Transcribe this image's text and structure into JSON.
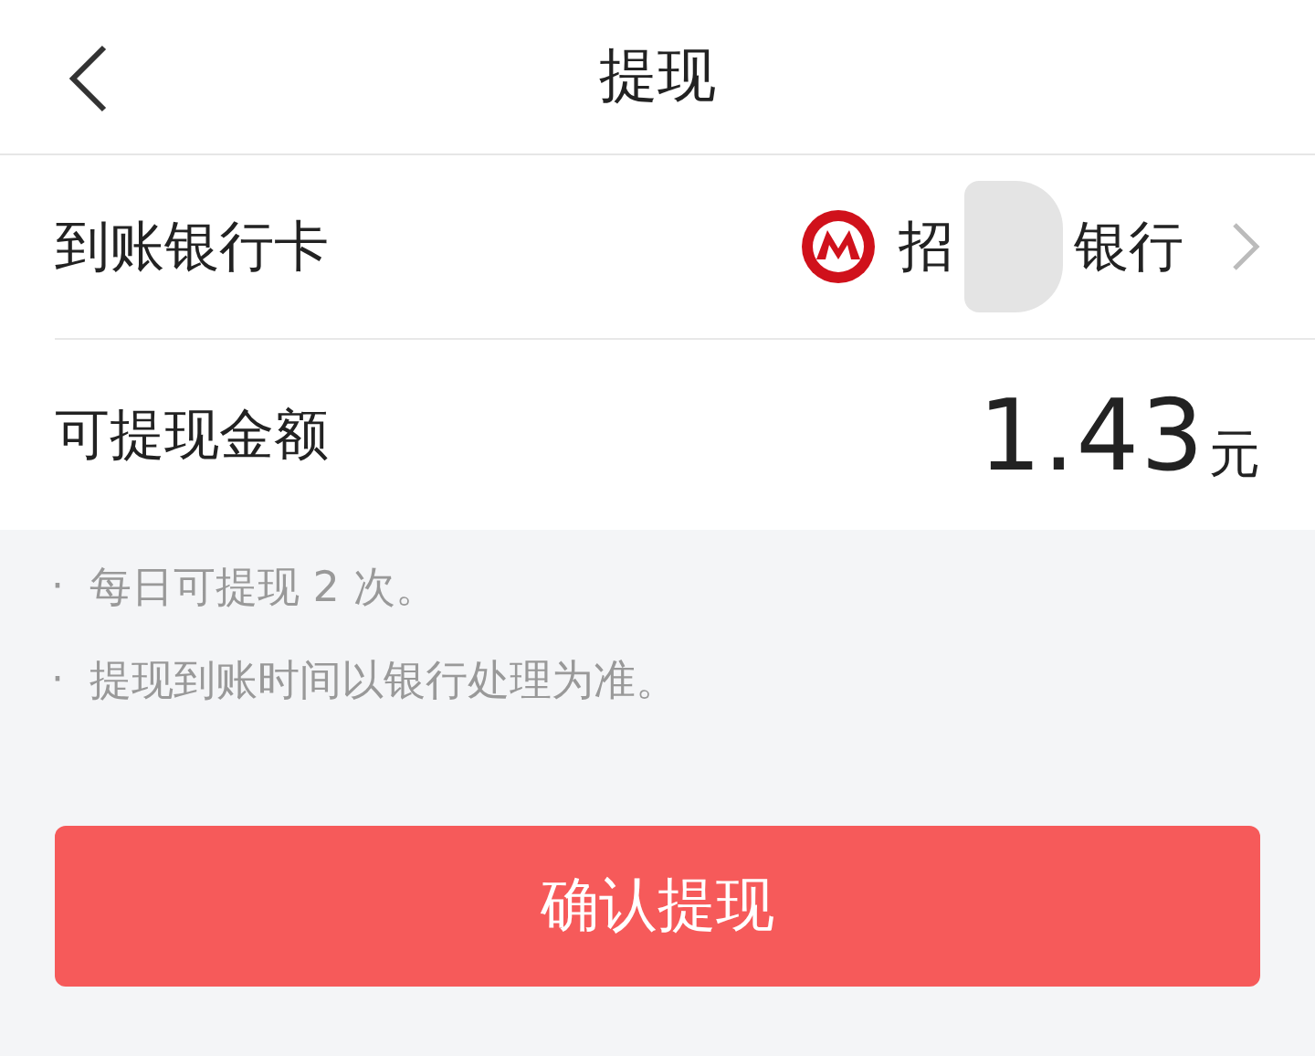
{
  "header": {
    "title": "提现"
  },
  "rows": [
    {
      "kind": "bank",
      "label": "到账银行卡",
      "bank_name_parts": [
        "招",
        "银行"
      ]
    },
    {
      "kind": "amount",
      "label": "可提现金额",
      "amount": "1.43",
      "unit": "元"
    }
  ],
  "notes": [
    {
      "bullet": "·",
      "text": "每日可提现 2 次。"
    },
    {
      "bullet": "·",
      "text": "提现到账时间以银行处理为准。"
    }
  ],
  "confirm_button": {
    "label": "确认提现"
  }
}
